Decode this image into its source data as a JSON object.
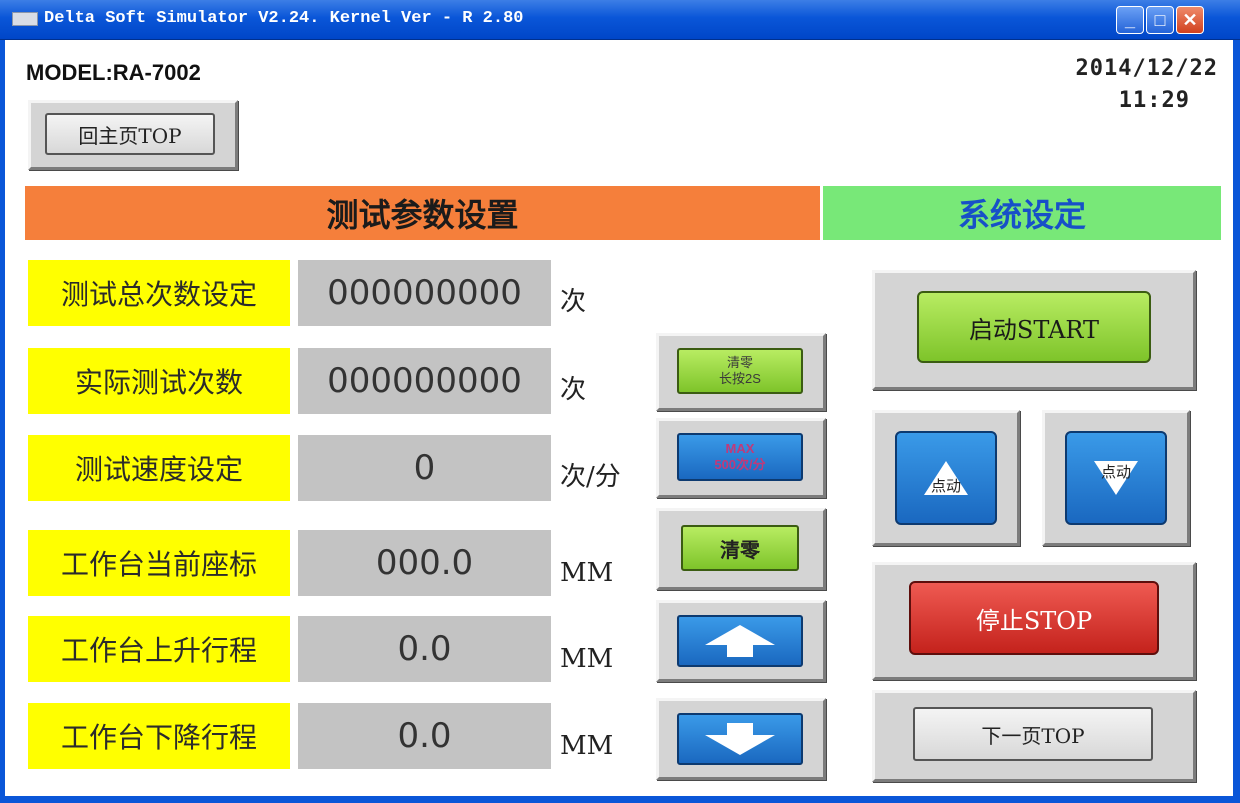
{
  "window": {
    "title": "Delta Soft Simulator V2.24. Kernel Ver - R 2.80",
    "min_glyph": "_",
    "max_glyph": "□",
    "close_glyph": "✕"
  },
  "header": {
    "model": "MODEL:RA-7002",
    "date": "2014/12/22",
    "time": "11:29",
    "home_button": "回主页TOP"
  },
  "sections": {
    "test_params": "测试参数设置",
    "system_settings": "系统设定"
  },
  "params": [
    {
      "label": "测试总次数设定",
      "value": "000000000",
      "unit": "次"
    },
    {
      "label": "实际测试次数",
      "value": "000000000",
      "unit": "次"
    },
    {
      "label": "测试速度设定",
      "value": "0",
      "unit": "次/分"
    },
    {
      "label": "工作台当前座标",
      "value": "000.0",
      "unit": "MM"
    },
    {
      "label": "工作台上升行程",
      "value": "0.0",
      "unit": "MM"
    },
    {
      "label": "工作台下降行程",
      "value": "0.0",
      "unit": "MM"
    }
  ],
  "controls": {
    "reset_hold_line1": "清零",
    "reset_hold_line2": "长按2S",
    "max_line1": "MAX",
    "max_line2": "500次/分",
    "reset": "清零"
  },
  "system": {
    "start": "启动START",
    "jog_up": "点动",
    "jog_down": "点动",
    "stop": "停止STOP",
    "next_page": "下一页TOP"
  },
  "colors": {
    "title_bar": "#0a56d8",
    "orange_header": "#f57f3b",
    "green_header": "#78e878",
    "label_yellow": "#ffff00",
    "value_grey": "#c3c3c3",
    "system_text_blue": "#1750c8"
  }
}
